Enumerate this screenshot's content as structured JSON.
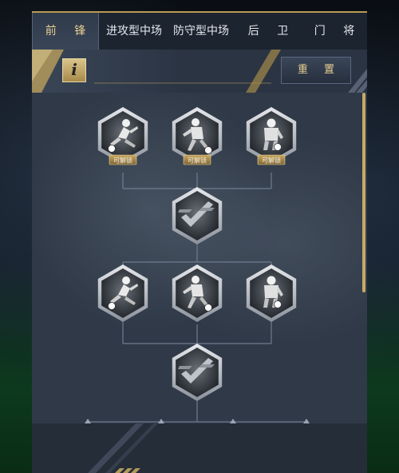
{
  "tabs": [
    {
      "label": "前 锋",
      "active": true
    },
    {
      "label": "进攻型中场",
      "active": false
    },
    {
      "label": "防守型中场",
      "active": false
    },
    {
      "label": "后 卫",
      "active": false
    },
    {
      "label": "门 将",
      "active": false
    }
  ],
  "info_button": {
    "label": "i"
  },
  "reset_button": {
    "label": "重 置"
  },
  "nodes": {
    "row1": [
      {
        "icon": "player-dribble-icon",
        "badge": "可解锁"
      },
      {
        "icon": "player-shoot-icon",
        "badge": "可解锁"
      },
      {
        "icon": "player-header-icon",
        "badge": "可解锁"
      }
    ],
    "hub1": {
      "icon": "skill-check-icon"
    },
    "row2": [
      {
        "icon": "player-dribble-icon"
      },
      {
        "icon": "player-shoot-icon"
      },
      {
        "icon": "player-header-icon"
      }
    ],
    "hub2": {
      "icon": "skill-check-icon"
    }
  },
  "colors": {
    "accent_gold": "#e7cf93",
    "panel": "#2c3542",
    "tab_bar": "#1c2430"
  }
}
